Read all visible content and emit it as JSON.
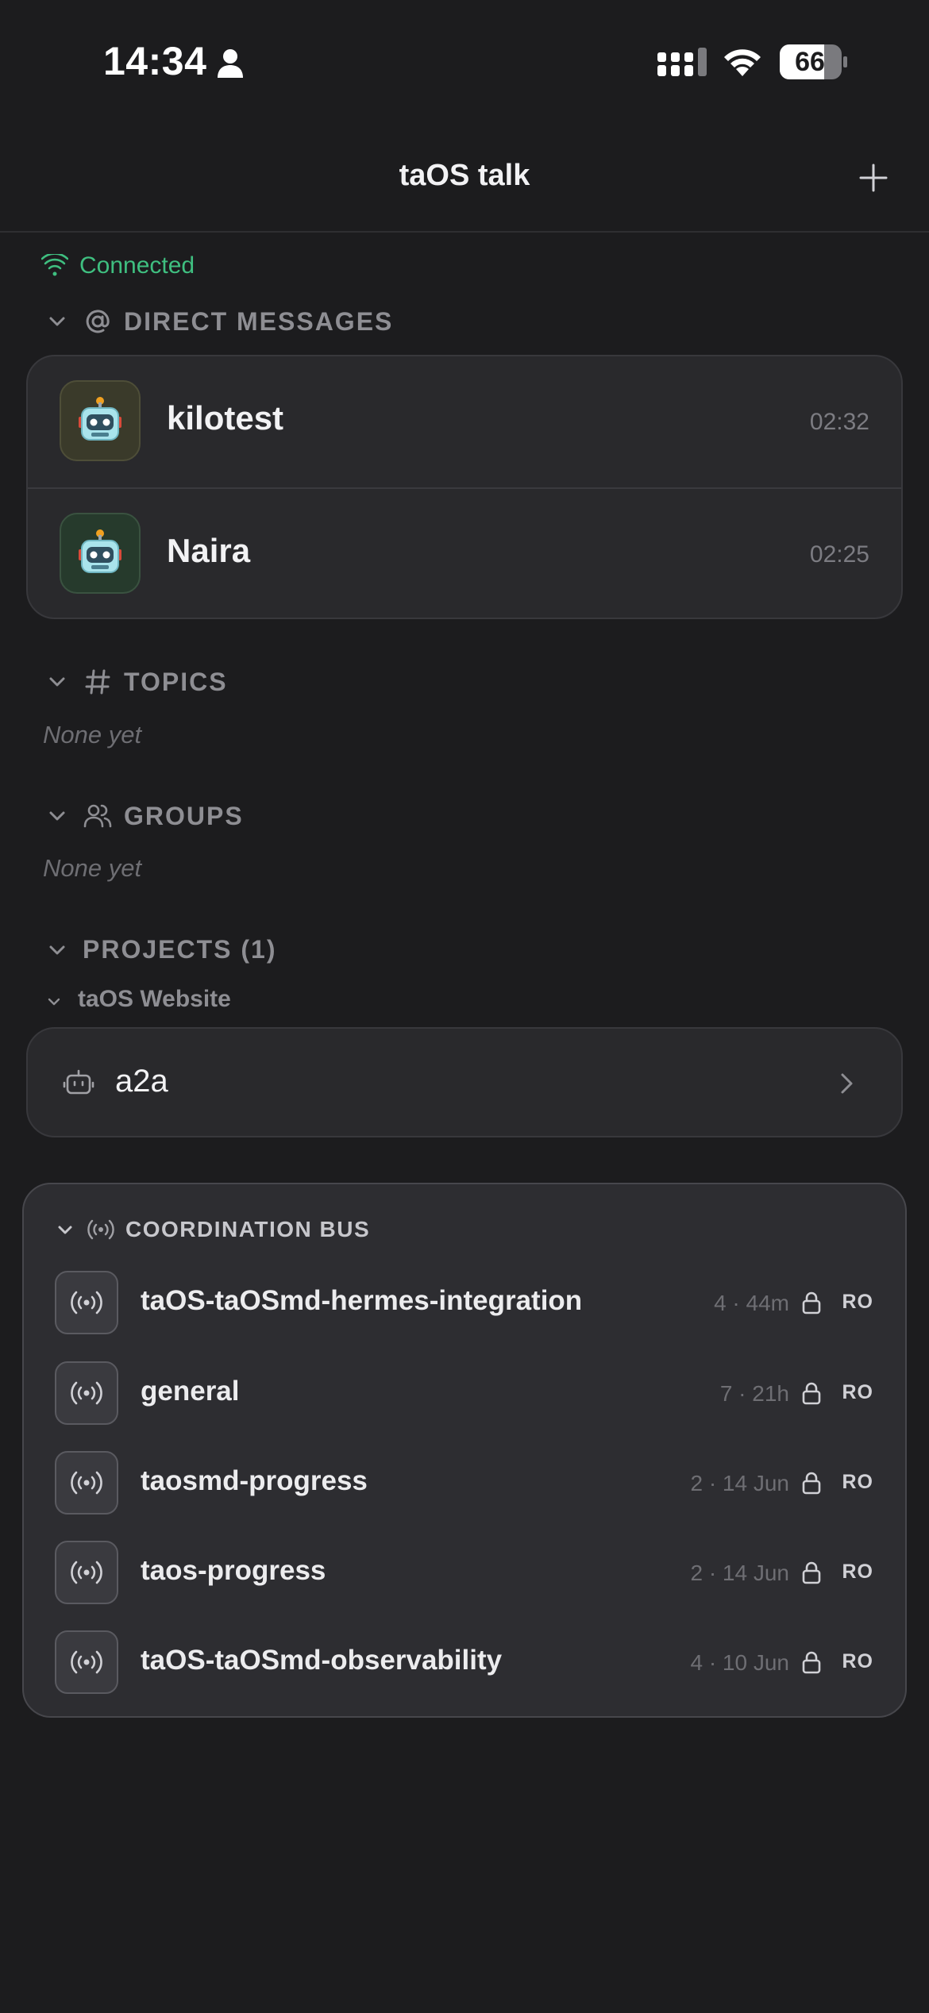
{
  "status_bar": {
    "time": "14:34",
    "battery": "66"
  },
  "nav": {
    "title": "taOS talk",
    "add_icon": "plus-icon"
  },
  "connection": {
    "label": "Connected",
    "color": "#3fbf80"
  },
  "direct_messages": {
    "header": "DIRECT MESSAGES",
    "items": [
      {
        "name": "kilotest",
        "time": "02:32",
        "avatar": "robot-emoji",
        "avatar_bg": "#3a3a2a"
      },
      {
        "name": "Naira",
        "time": "02:25",
        "avatar": "robot-emoji",
        "avatar_bg": "#263a2c"
      }
    ]
  },
  "topics": {
    "header": "TOPICS",
    "empty": "None yet"
  },
  "groups": {
    "header": "GROUPS",
    "empty": "None yet"
  },
  "projects": {
    "header": "PROJECTS (1)",
    "project_name": "taOS Website",
    "items": [
      {
        "label": "a2a",
        "icon": "bot-icon"
      }
    ]
  },
  "coordination_bus": {
    "header": "COORDINATION BUS",
    "channels": [
      {
        "name": "taOS-taOSmd-hermes-integration",
        "meta": "4 · 44m",
        "badge": "RO"
      },
      {
        "name": "general",
        "meta": "7 · 21h",
        "badge": "RO"
      },
      {
        "name": "taosmd-progress",
        "meta": "2 · 14 Jun",
        "badge": "RO"
      },
      {
        "name": "taos-progress",
        "meta": "2 · 14 Jun",
        "badge": "RO"
      },
      {
        "name": "taOS-taOSmd-observability",
        "meta": "4 · 10 Jun",
        "badge": "RO"
      }
    ]
  }
}
